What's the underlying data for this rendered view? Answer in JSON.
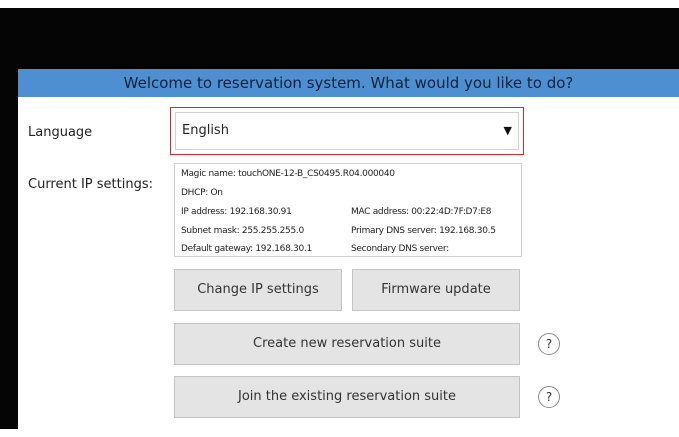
{
  "header": {
    "title": "Welcome to reservation system. What would you like to do?"
  },
  "language": {
    "label": "Language",
    "selected": "English",
    "arrow": "▼"
  },
  "ip_settings": {
    "label": "Current IP settings:",
    "magic_name": "Magic name: touchONE-12-B_CS0495.R04.000040",
    "dhcp": "DHCP: On",
    "ip_address": "IP address: 192.168.30.91",
    "mac_address": "MAC address: 00:22:4D:7F:D7:E8",
    "subnet_mask": "Subnet mask: 255.255.255.0",
    "primary_dns": "Primary DNS server: 192.168.30.5",
    "default_gateway": "Default gateway: 192.168.30.1",
    "secondary_dns": "Secondary DNS server:"
  },
  "buttons": {
    "change_ip": "Change IP settings",
    "firmware": "Firmware update",
    "create_suite": "Create new reservation suite",
    "join_suite": "Join the existing reservation suite",
    "help": "?"
  },
  "colors": {
    "header_bg": "#4e8fd2",
    "frame": "#050505",
    "focus_outline": "#d9262e",
    "button_bg": "#e4e4e4"
  },
  "icons": {
    "dropdown": "chevron-down-icon",
    "help": "question-mark-icon"
  }
}
